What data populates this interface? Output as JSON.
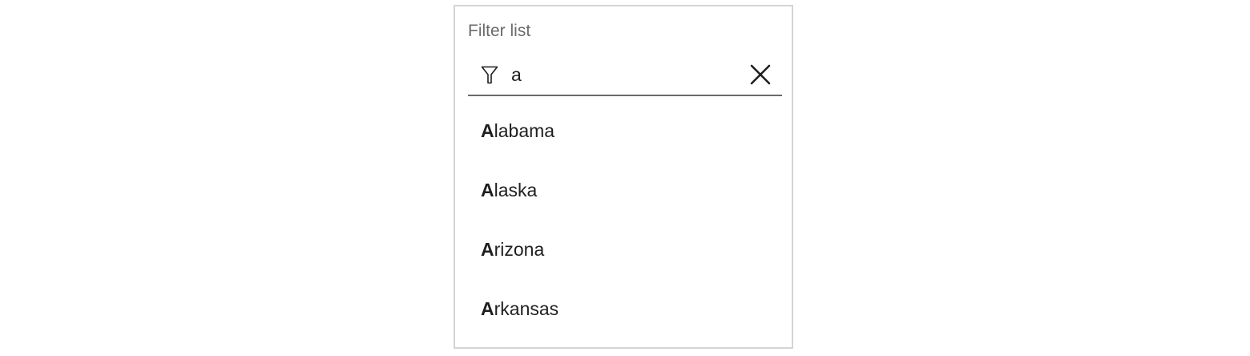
{
  "filter": {
    "label": "Filter list",
    "value": "a",
    "icon": "filter-icon",
    "clear_icon": "close-icon"
  },
  "list": {
    "items": [
      {
        "match": "A",
        "rest": "labama"
      },
      {
        "match": "A",
        "rest": "laska"
      },
      {
        "match": "A",
        "rest": "rizona"
      },
      {
        "match": "A",
        "rest": "rkansas"
      }
    ]
  },
  "colors": {
    "panel_border": "#d4d4d6",
    "label_text": "#6b6b6e",
    "body_text": "#1f1f22",
    "underline": "#6a6a70"
  }
}
